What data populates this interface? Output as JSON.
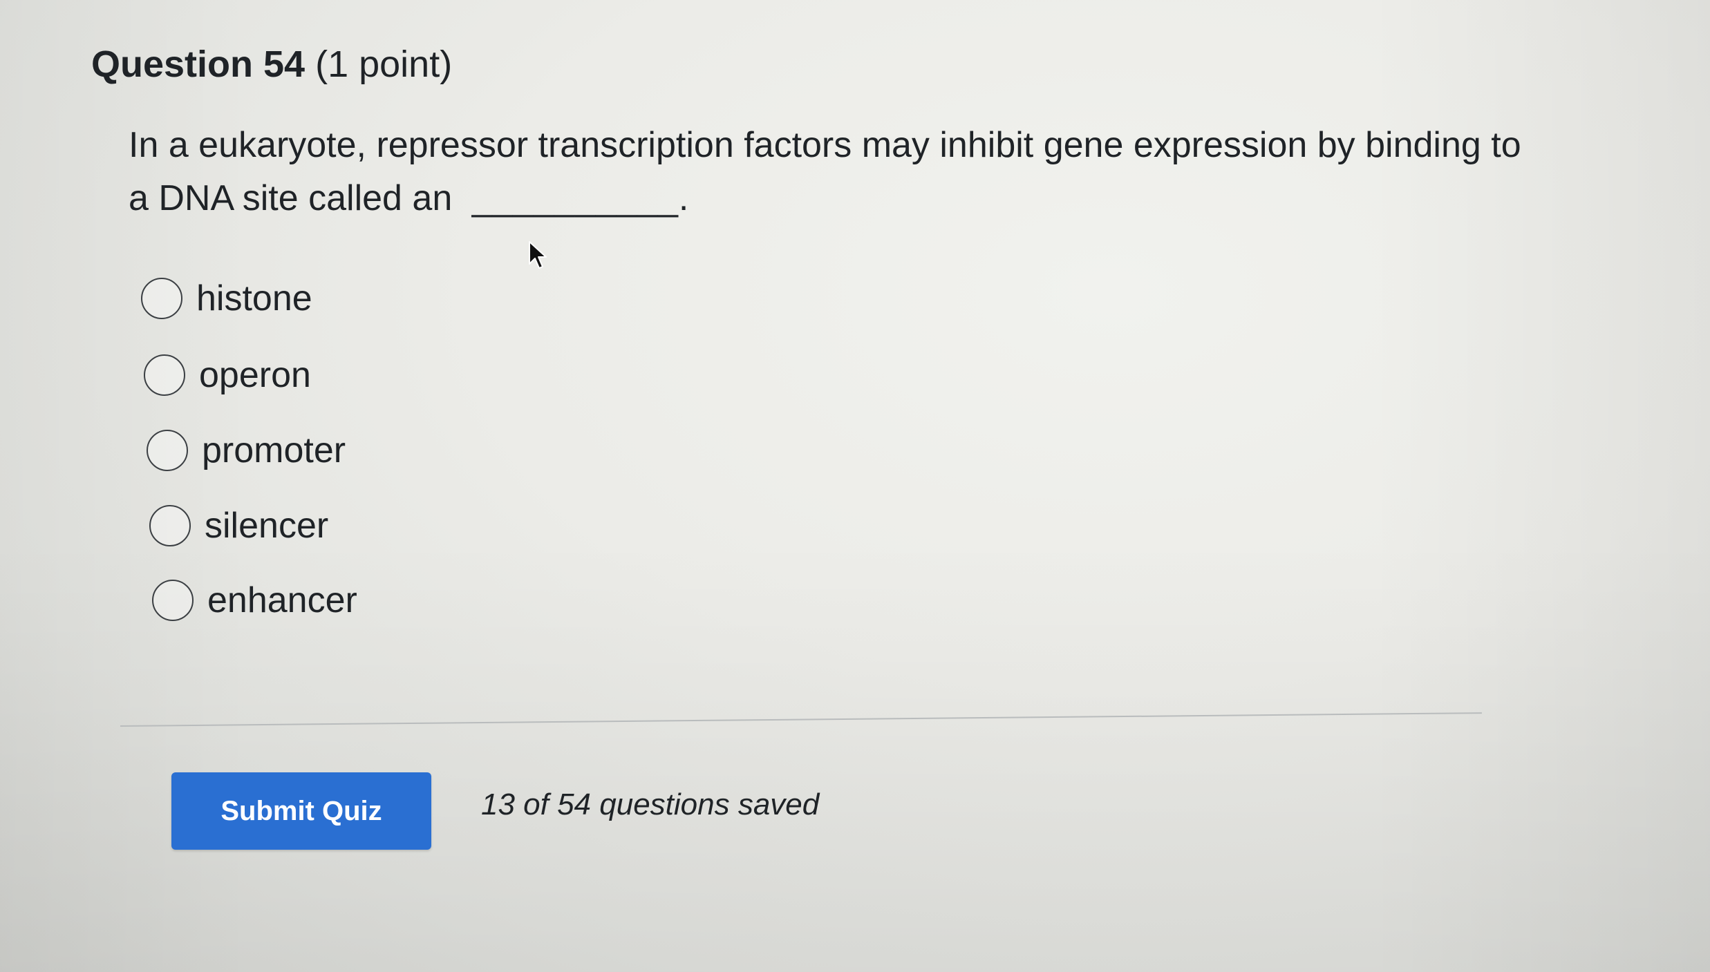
{
  "question": {
    "title": "Question 54",
    "points": "(1 point)",
    "text": "In a eukaryote, repressor transcription factors may inhibit gene expression by binding to a DNA site called an",
    "blank": "__________."
  },
  "options": [
    {
      "label": "histone",
      "selected": false
    },
    {
      "label": "operon",
      "selected": false
    },
    {
      "label": "promoter",
      "selected": false
    },
    {
      "label": "silencer",
      "selected": false
    },
    {
      "label": "enhancer",
      "selected": false
    }
  ],
  "footer": {
    "submit_label": "Submit Quiz",
    "save_status": "13 of 54 questions saved"
  },
  "colors": {
    "submit_button": "#2a6fd2",
    "text": "#1f2327",
    "background": "#ecece8"
  },
  "icons": {
    "cursor": "mouse-pointer-icon"
  }
}
